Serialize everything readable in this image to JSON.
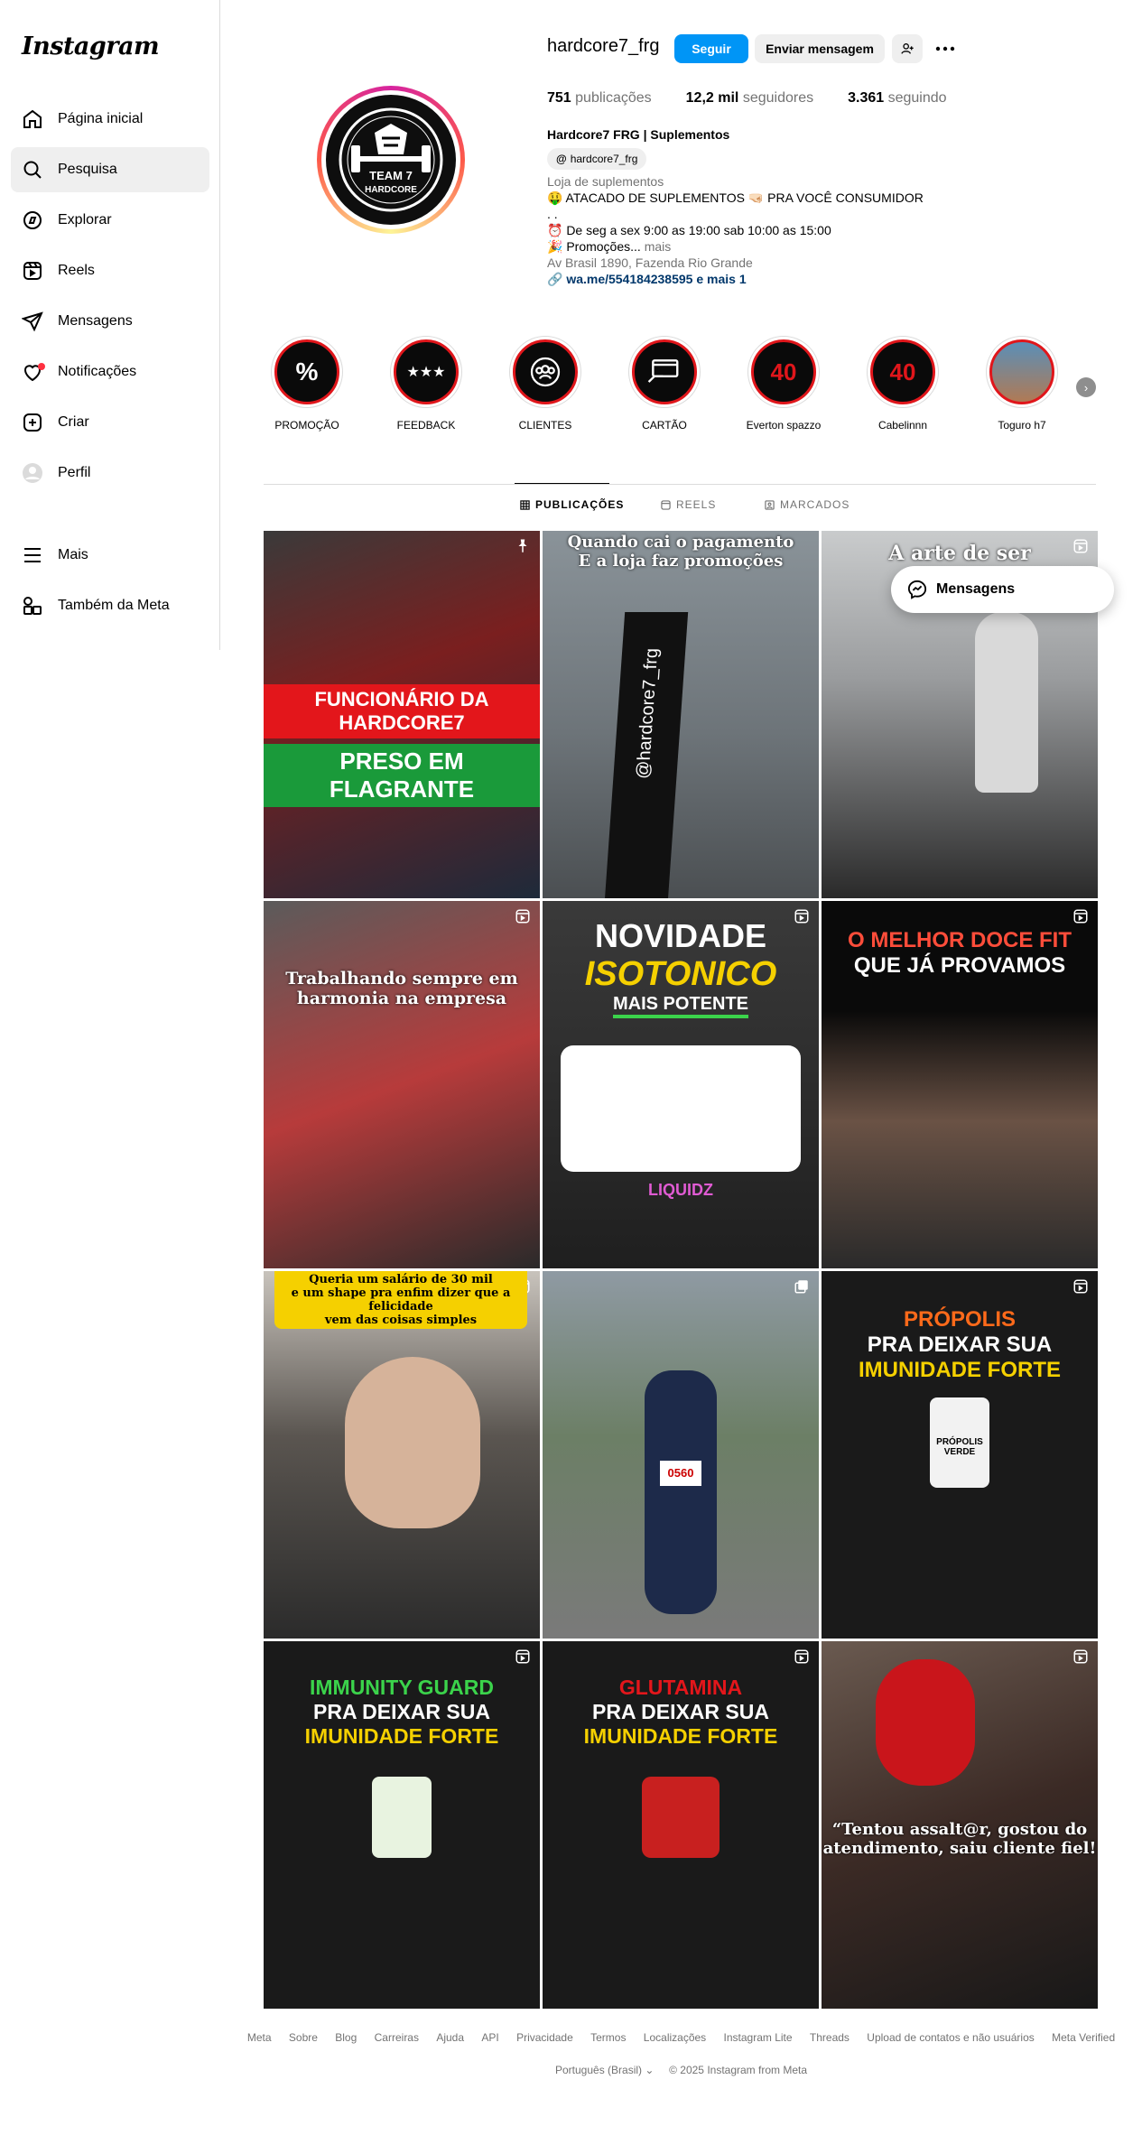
{
  "app": {
    "logo": "Instagram"
  },
  "sidebar": {
    "items": [
      {
        "label": "Página inicial",
        "icon": "home-icon"
      },
      {
        "label": "Pesquisa",
        "icon": "search-icon"
      },
      {
        "label": "Explorar",
        "icon": "compass-icon"
      },
      {
        "label": "Reels",
        "icon": "reels-icon"
      },
      {
        "label": "Mensagens",
        "icon": "send-icon"
      },
      {
        "label": "Notificações",
        "icon": "heart-icon"
      },
      {
        "label": "Criar",
        "icon": "plus-square-icon"
      },
      {
        "label": "Perfil",
        "icon": "avatar-icon"
      }
    ],
    "more": [
      {
        "label": "Mais",
        "icon": "menu-icon"
      },
      {
        "label": "Também da Meta",
        "icon": "meta-apps-icon"
      }
    ]
  },
  "profile": {
    "username": "hardcore7_frg",
    "follow_label": "Seguir",
    "message_label": "Enviar mensagem",
    "avatar_text": "TEAM 7 HARDCORE",
    "stats": {
      "posts_count": "751",
      "posts_label": "publicações",
      "followers_count": "12,2 mil",
      "followers_label": "seguidores",
      "following_count": "3.361",
      "following_label": "seguindo"
    },
    "bio": {
      "name": "Hardcore7 FRG | Suplementos",
      "threads_handle": "hardcore7_frg",
      "category": "Loja de suplementos",
      "line1": "🤑 ATACADO DE SUPLEMENTOS 🤜🏻 PRA VOCÊ CONSUMIDOR",
      "line2": ". .",
      "line3": "⏰ De seg a sex 9:00 as 19:00 sab 10:00 as 15:00",
      "line4": "🎉 Promoções...",
      "more": "mais",
      "address": "Av Brasil 1890, Fazenda Rio Grande",
      "link": "wa.me/554184238595 e mais 1"
    }
  },
  "highlights": [
    {
      "label": "PROMOÇÃO",
      "icon": "percent-icon"
    },
    {
      "label": "FEEDBACK",
      "icon": "star-rating-icon"
    },
    {
      "label": "CLIENTES",
      "icon": "people-icon"
    },
    {
      "label": "CARTÃO",
      "icon": "card-icon"
    },
    {
      "label": "Everton spazzo",
      "icon": "projeto-40-icon"
    },
    {
      "label": "Cabelinnn",
      "icon": "projeto-40-icon"
    },
    {
      "label": "Toguro h7",
      "icon": "photo-icon"
    }
  ],
  "tabs": [
    {
      "label": "PUBLICAÇÕES",
      "icon": "grid-icon"
    },
    {
      "label": "REELS",
      "icon": "reels-icon"
    },
    {
      "label": "MARCADOS",
      "icon": "tag-icon"
    }
  ],
  "posts": [
    {
      "l1": "FUNCIONÁRIO DA HARDCORE7",
      "l2": "PRESO EM FLAGRANTE",
      "badge": "pin-icon"
    },
    {
      "l1": "Quando cai o pagamento",
      "l2": "E a loja faz promoções",
      "extra": "@hardcore7_frg"
    },
    {
      "l1": "A arte de ser",
      "l2": "",
      "badge": "reel-icon"
    },
    {
      "l1": "Trabalhando sempre em",
      "l2": "harmonia na empresa",
      "badge": "reel-icon"
    },
    {
      "l1": "NOVIDADE",
      "l2": "ISOTONICO",
      "l3": "MAIS POTENTE",
      "extra": "LIQUIDZ",
      "badge": "reel-icon"
    },
    {
      "l1": "O MELHOR DOCE FIT",
      "l2": "QUE JÁ PROVAMOS",
      "badge": "reel-icon"
    },
    {
      "l1": "Queria um salário de 30 mil",
      "l2": "e um shape pra enfim dizer que a felicidade",
      "l3": "vem das coisas simples",
      "badge": "reel-icon"
    },
    {
      "l1": "",
      "l2": "",
      "extra": "0560",
      "badge": "carousel-icon"
    },
    {
      "l1": "PRÓPOLIS",
      "l2": "PRA DEIXAR SUA",
      "l3": "IMUNIDADE FORTE",
      "extra": "PRÓPOLIS VERDE",
      "badge": "reel-icon"
    },
    {
      "l1": "IMMUNITY GUARD",
      "l2": "PRA DEIXAR SUA",
      "l3": "IMUNIDADE FORTE",
      "badge": "reel-icon"
    },
    {
      "l1": "GLUTAMINA",
      "l2": "PRA DEIXAR SUA",
      "l3": "IMUNIDADE FORTE",
      "badge": "reel-icon"
    },
    {
      "l1": "“Tentou assalt@r, gostou do",
      "l2": "atendimento, saiu cliente fiel!",
      "badge": "reel-icon"
    }
  ],
  "messages_popup": {
    "label": "Mensagens"
  },
  "footer": {
    "links": [
      "Meta",
      "Sobre",
      "Blog",
      "Carreiras",
      "Ajuda",
      "API",
      "Privacidade",
      "Termos",
      "Localizações",
      "Instagram Lite",
      "Threads",
      "Upload de contatos e não usuários",
      "Meta Verified"
    ],
    "language": "Português (Brasil)",
    "copyright": "© 2025 Instagram from Meta"
  },
  "colors": {
    "accent": "#0095f6",
    "highlight_ring": "#e0161b",
    "link": "#00376b",
    "muted": "#737373"
  }
}
